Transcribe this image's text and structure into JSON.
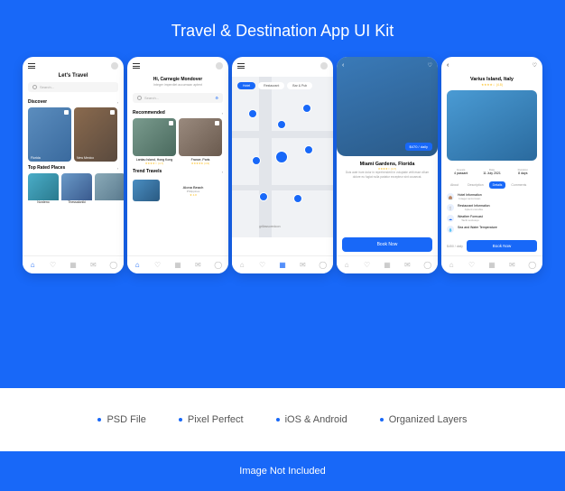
{
  "title": "Travel & Destination App UI Kit",
  "features": [
    "PSD File",
    "Pixel Perfect",
    "iOS & Android",
    "Organized Layers"
  ],
  "footer": "Image Not Included",
  "s1": {
    "title": "Let's Travel",
    "search": "Search...",
    "discover": "Discover",
    "cards": [
      {
        "name": "Florida"
      },
      {
        "name": "New Mexico"
      }
    ],
    "top": "Top Rated Places",
    "small": [
      {
        "name": "Nordeno"
      },
      {
        "name": "Thessaloniki"
      },
      {
        "name": ""
      }
    ]
  },
  "s2": {
    "greet": "Hi, Carnegie Mondover",
    "sub": "Integer imperdiet accumsan aptent",
    "search": "Search...",
    "rec": "Recommended",
    "recs": [
      {
        "name": "Lantau Island, Hong Kong",
        "rate": "★★★★☆ (4.7)"
      },
      {
        "name": "France, Paris",
        "rate": "★★★★★ (4.9)"
      }
    ],
    "trend": "Trend Travels",
    "trends": [
      {
        "name": "Alona Beach",
        "loc": "Philippines",
        "rate": "★ 4.8"
      }
    ]
  },
  "s3": {
    "chips": [
      "Hotel",
      "Restaurant",
      "Bar & Pub"
    ],
    "area": "grillassuredcon"
  },
  "s4": {
    "price": "$470 / daily",
    "title": "Miami Gardens, Florida",
    "rate": "★★★★☆ (4.7)",
    "desc": "Duis aute irure dolor in reprehenderit in voluptate velit esse cillum dolore eu fugiat nulla pariatur excepteur sint occaecat.",
    "book": "Book Now"
  },
  "s5": {
    "title": "Varius Island, Italy",
    "rate": "★★★★☆ (4.8)",
    "guests_l": "Guests",
    "guests_v": "4 passant",
    "date_l": "Date",
    "date_v": "11 July 2021",
    "dur_l": "Duration",
    "dur_v": "8 days",
    "tabs": [
      "About",
      "Description",
      "Details",
      "Comments"
    ],
    "info": [
      {
        "t": "Hotel Information",
        "s": "Integer accumsan"
      },
      {
        "t": "Restaurant Information",
        "s": "Aptent conubia"
      },
      {
        "t": "Weather Forecast",
        "s": "Taciti sociosqu"
      },
      {
        "t": "Sea and Water Temperature",
        "s": "Litora torquent"
      }
    ],
    "price": "$450 / daily",
    "book": "Book Now"
  }
}
